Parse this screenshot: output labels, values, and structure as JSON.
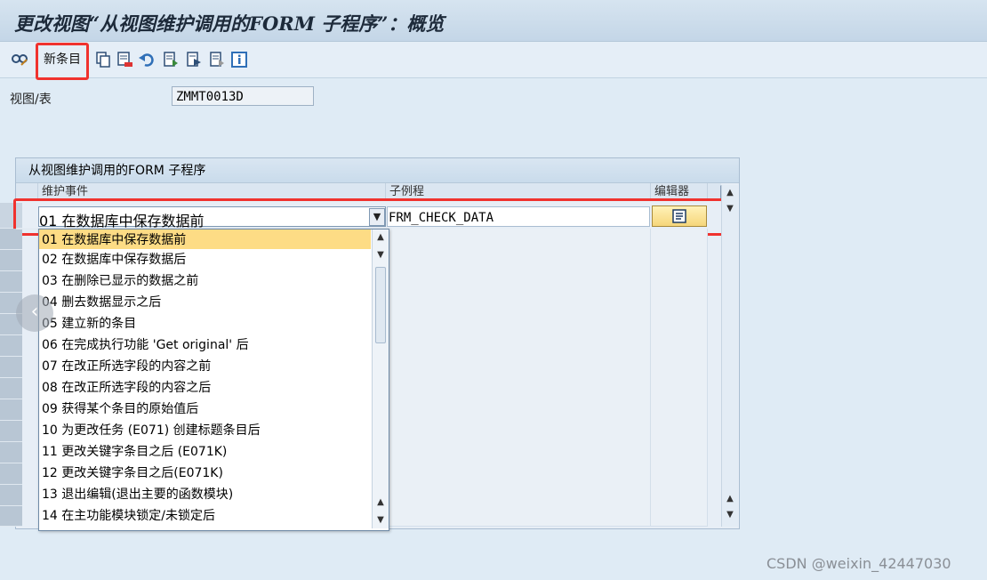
{
  "window": {
    "title": "更改视图“从视图维护调用的FORM 子程序”：概览"
  },
  "toolbar": {
    "new_entries_label": "新条目",
    "icons": [
      "glasses-change-icon",
      "copy-icon",
      "delete-icon",
      "undo-icon",
      "select-all-icon",
      "select-block-icon",
      "deselect-all-icon",
      "info-icon"
    ]
  },
  "header": {
    "view_label": "视图/表",
    "view_value": "ZMMT0013D"
  },
  "table": {
    "title": "从视图维护调用的FORM 子程序",
    "columns": [
      "维护事件",
      "子例程",
      "编辑器"
    ],
    "row1": {
      "event": "01  在数据库中保存数据前",
      "subroutine": "FRM_CHECK_DATA",
      "editor_icon": "editor-icon"
    }
  },
  "dropdown": {
    "selected_index": 0,
    "options": [
      "01  在数据库中保存数据前",
      "02  在数据库中保存数据后",
      "03  在删除已显示的数据之前",
      "04  删去数据显示之后",
      "05  建立新的条目",
      "06  在完成执行功能 'Get original' 后",
      "07  在改正所选字段的内容之前",
      "08  在改正所选字段的内容之后",
      "09  获得某个条目的原始值后",
      "10  为更改任务 (E071) 创建标题条目后",
      "11  更改关键字条目之后 (E071K)",
      "12  更改关键字条目之后(E071K)",
      "13  退出编辑(退出主要的函数模块)",
      "14  在主功能模块锁定/未锁定后"
    ]
  },
  "watermark": "CSDN @weixin_42447030",
  "colors": {
    "highlight": "#f0322e",
    "selected_option": "#fddc85",
    "background": "#dfebf5"
  }
}
